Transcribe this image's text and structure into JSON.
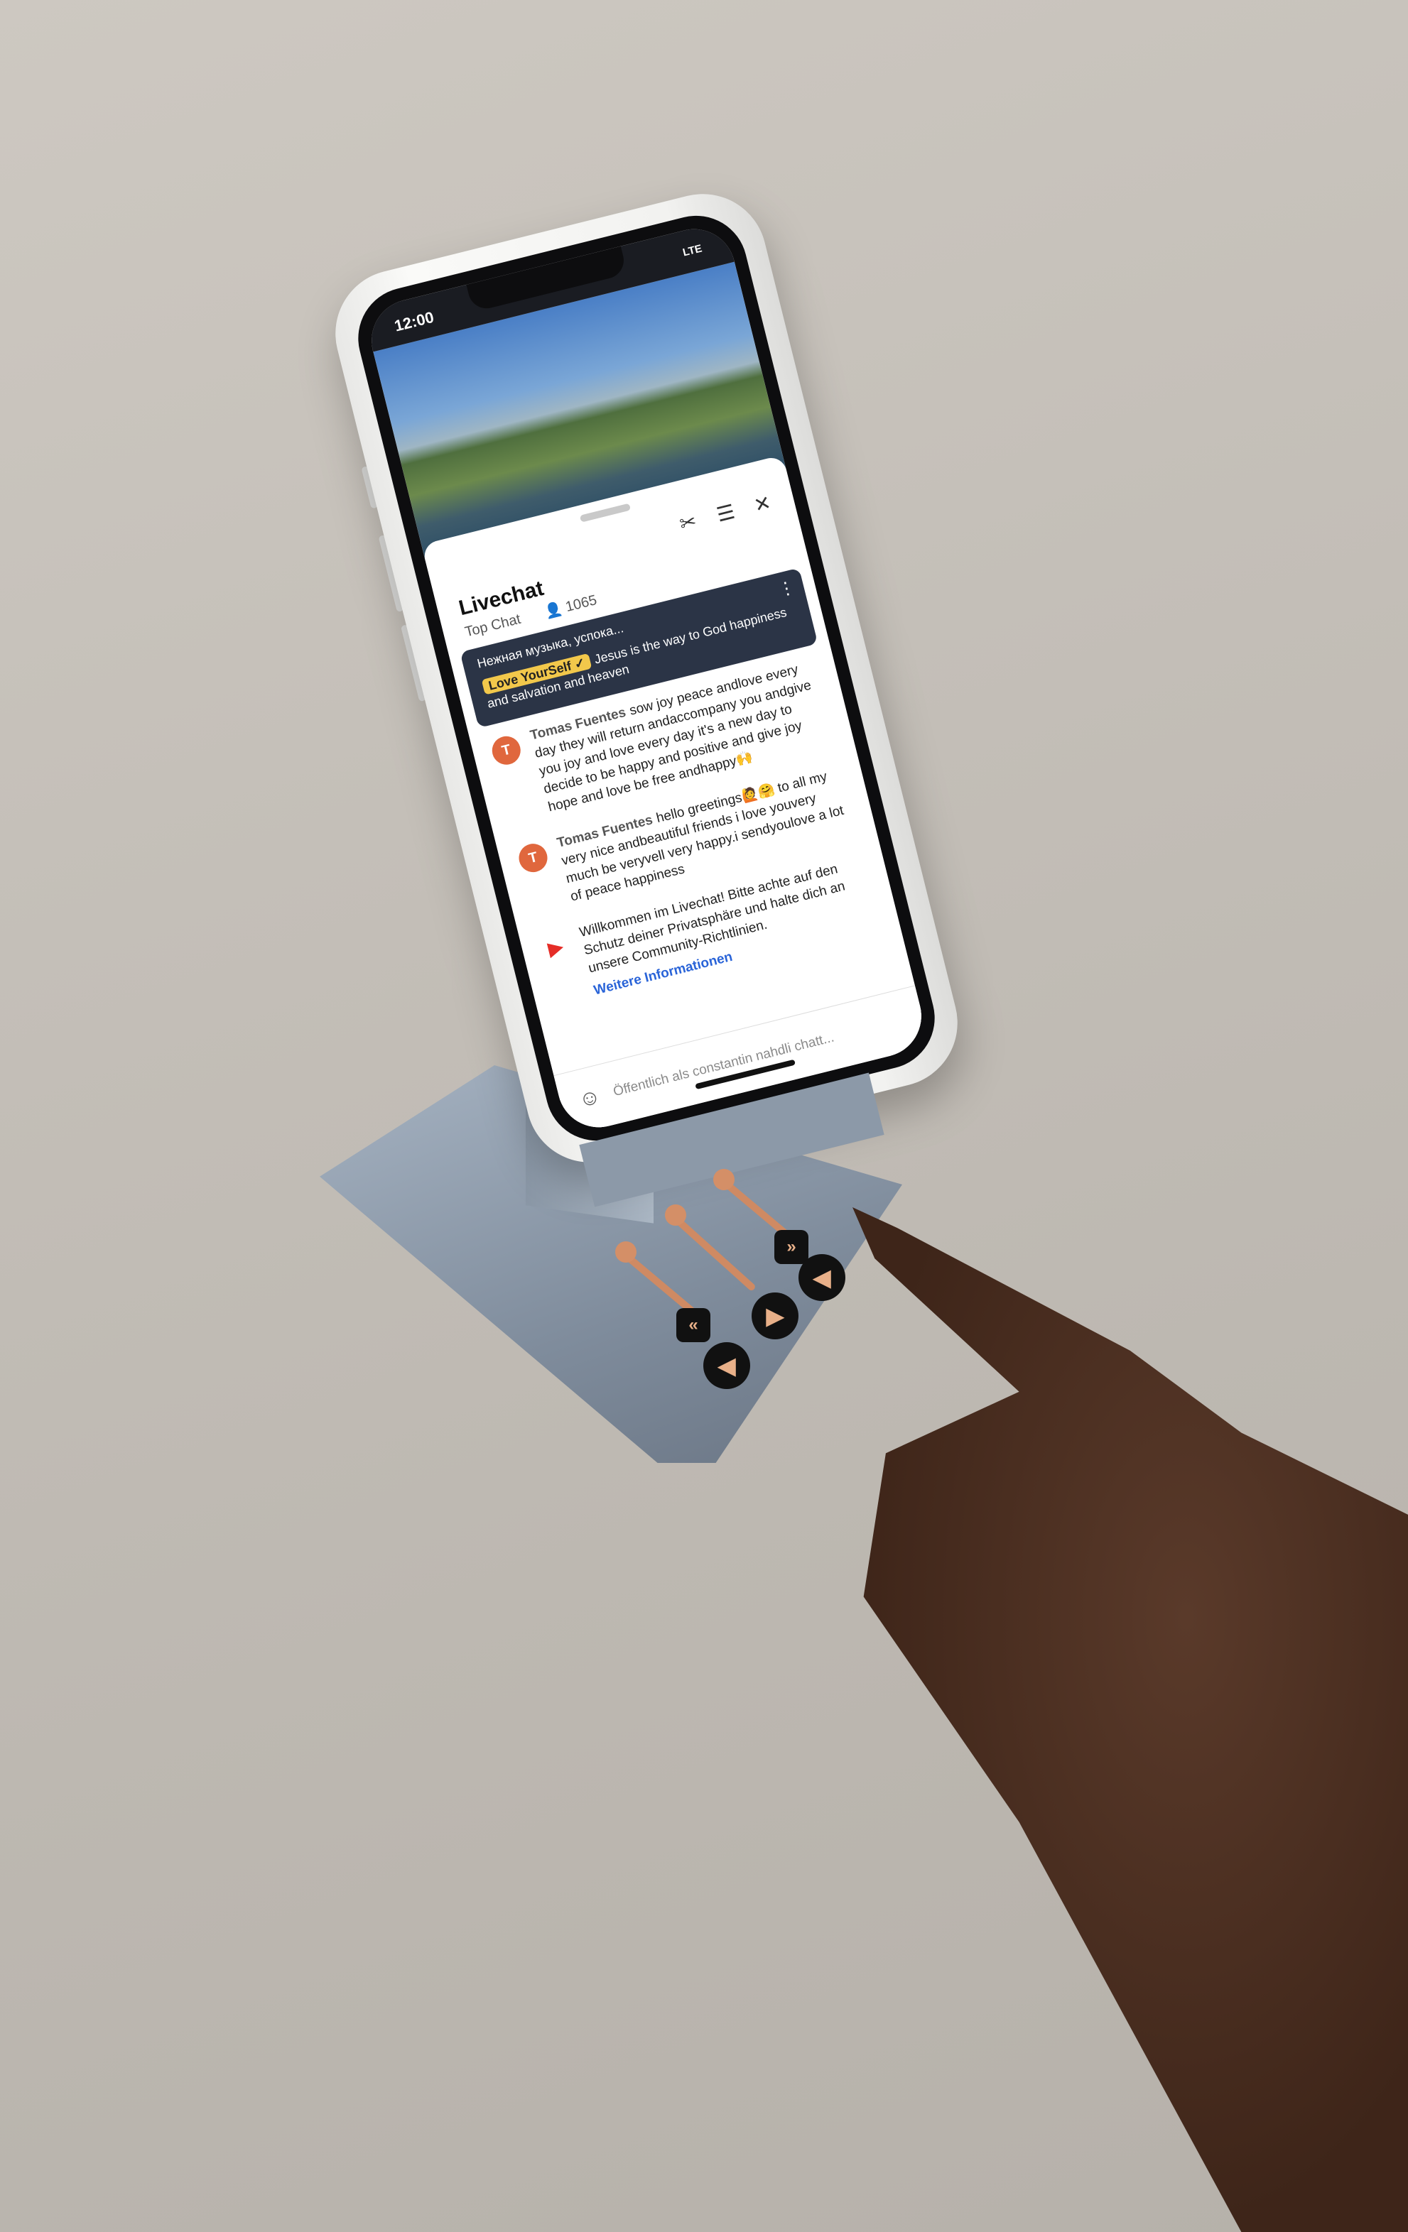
{
  "phone": {
    "status_time": "12:00",
    "status_network": "LTE",
    "chat": {
      "title": "Livechat",
      "filter": "Top Chat",
      "viewer_count": "1065",
      "pinned": {
        "top_text": "Нежная музыка, успока...",
        "badge": "Love YourSelf ✓",
        "body": "Jesus is the way to God happiness and salvation and heaven"
      },
      "messages": [
        {
          "avatar": "T",
          "author": "Tomas Fuentes",
          "text": "sow joy peace andlove every day they will return andaccompany you andgive you joy and love every day it's a new day to decide to be happy and positive and give joy hope and love be free andhappy🙌"
        },
        {
          "avatar": "T",
          "author": "Tomas Fuentes",
          "text": "hello greetings🙋🤗 to all my very nice andbeautiful friends i love youvery much be veryvell very happy.i sendyoulove a lot of peace happiness"
        },
        {
          "avatar": "▶",
          "author": "",
          "text": "Willkommen im Livechat! Bitte achte auf den Schutz deiner Privatsphäre und halte dich an unsere Community-Richtlinien.",
          "link": "Weitere Informationen"
        }
      ],
      "input_placeholder": "Öffentlich als constantin nahdli chatt..."
    }
  },
  "icons": [
    "scissors-icon",
    "sliders-icon",
    "close-icon",
    "user-icon",
    "more-icon",
    "emoji-icon",
    "previous-icon",
    "play-pause-icon",
    "next-icon",
    "volume-down-icon",
    "volume-up-icon"
  ],
  "colors": {
    "pinned_bg": "#2b3446",
    "badge": "#f2c84b",
    "avatar": "#e0673d",
    "link": "#2a64d8",
    "copper": "#cf8a63",
    "stand": "#8c99a8"
  }
}
